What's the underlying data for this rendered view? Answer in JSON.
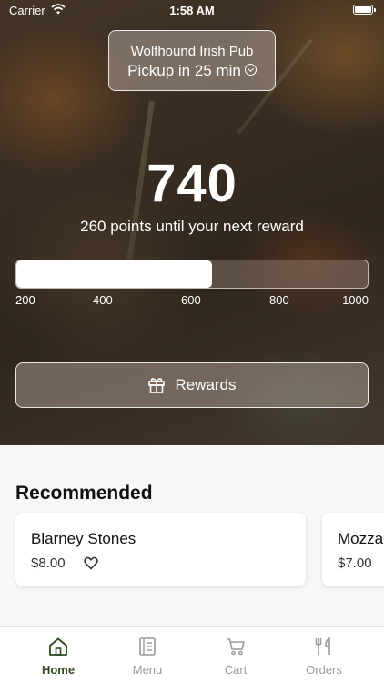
{
  "status_bar": {
    "carrier": "Carrier",
    "time": "1:58 AM"
  },
  "store": {
    "name": "Wolfhound Irish Pub",
    "pickup": "Pickup in 25 min"
  },
  "points": {
    "value": "740",
    "caption": "260 points until your next reward",
    "progress_min": 200,
    "progress_max": 1000,
    "progress_current": 740,
    "ticks": [
      "200",
      "400",
      "600",
      "800",
      "1000"
    ]
  },
  "rewards_button": {
    "label": "Rewards",
    "icon": "gift-icon"
  },
  "recommended": {
    "title": "Recommended",
    "items": [
      {
        "name": "Blarney Stones",
        "price": "$8.00"
      },
      {
        "name": "Mozza",
        "price": "$7.00"
      }
    ]
  },
  "tabs": [
    {
      "label": "Home",
      "icon": "home-icon",
      "active": true
    },
    {
      "label": "Menu",
      "icon": "menu-icon",
      "active": false
    },
    {
      "label": "Cart",
      "icon": "cart-icon",
      "active": false
    },
    {
      "label": "Orders",
      "icon": "orders-icon",
      "active": false
    }
  ],
  "colors": {
    "accent": "#2f4a1e",
    "inactive": "#9a9a9a"
  }
}
